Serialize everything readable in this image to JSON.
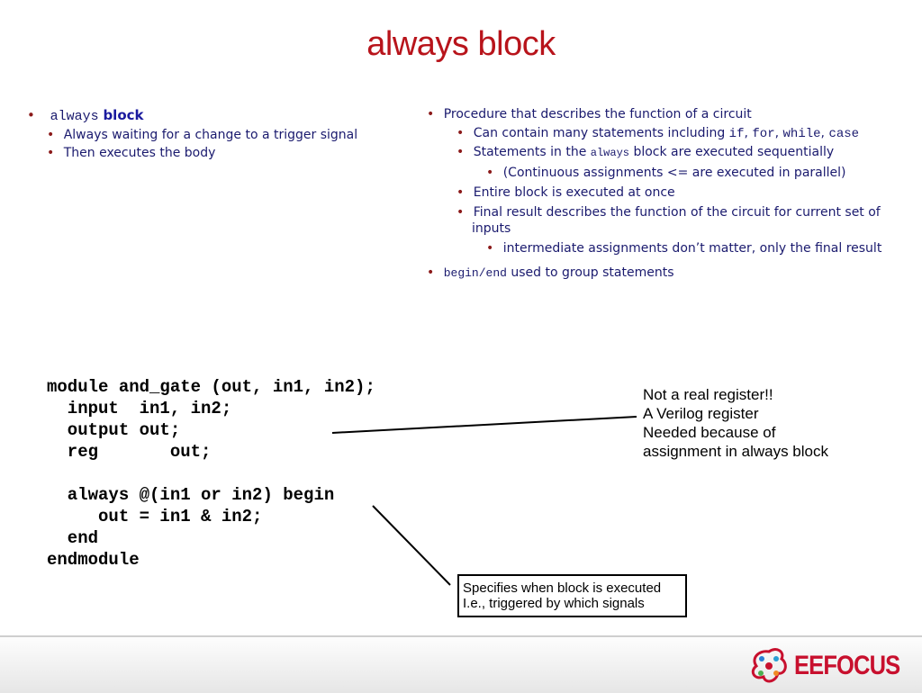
{
  "slide": {
    "title": "always block",
    "left_bullets": {
      "main_code": "always",
      "main_text": "block",
      "sub": [
        "Always waiting for a change to a trigger signal",
        "Then executes the body"
      ]
    },
    "right_bullets": {
      "b1": "Procedure that describes the function of a circuit",
      "b1_sub1_text": "Can contain many statements including ",
      "b1_sub1_kw": [
        "if",
        "for",
        "while",
        "case"
      ],
      "b1_sub2_pre": "Statements in the ",
      "b1_sub2_code": "always",
      "b1_sub2_post": " block are executed sequentially",
      "b1_sub2_sub": "(Continuous assignments <= are executed in parallel)",
      "b1_sub3": "Entire block is executed at once",
      "b1_sub4_line1": "Final result describes the function of the circuit for current set of",
      "b1_sub4_line2": "inputs",
      "b1_sub4_sub": "intermediate assignments don’t matter, only the final result",
      "b2_code": "begin/end",
      "b2_text": " used to group statements"
    },
    "code_lines": [
      "module and_gate (out, in1, in2);",
      "  input  in1, in2;",
      "  output out;",
      "  reg       out;",
      "",
      "  always @(in1 or in2) begin",
      "     out = in1 & in2;",
      "  end",
      "endmodule"
    ],
    "annotation_register": [
      "Not a real register!!",
      "A Verilog register",
      "Needed because of",
      "assignment in always block"
    ],
    "annotation_trigger": [
      "Specifies when block is executed",
      "I.e., triggered by which signals"
    ],
    "footer": {
      "logo_text": "EEFOCUS"
    },
    "colors": {
      "title": "#b8141b",
      "body_text": "#1a1a6e",
      "bullet": "#8b1a1a",
      "logo": "#c8102e"
    }
  }
}
